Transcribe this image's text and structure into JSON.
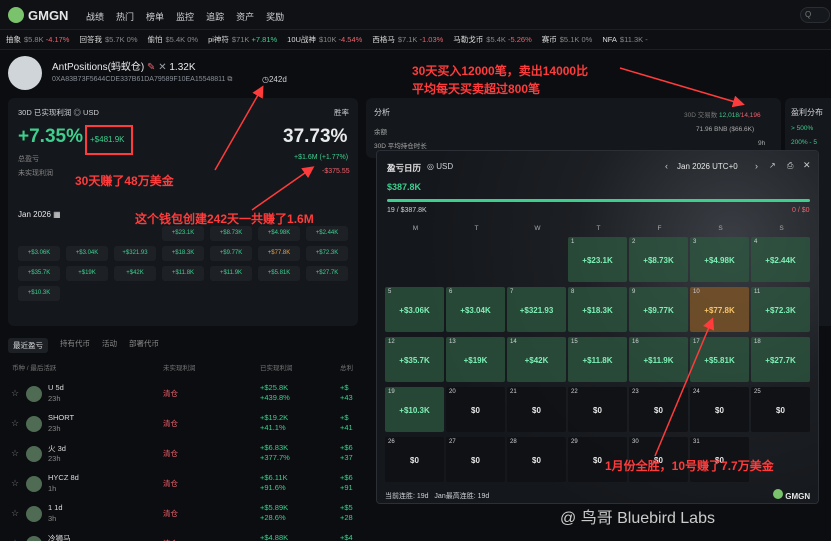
{
  "nav": {
    "brand": "GMGN",
    "links": [
      "战绩",
      "热门",
      "榜单",
      "监控",
      "追踪",
      "资产",
      "奖励"
    ],
    "search_label": "Q"
  },
  "ticker": [
    {
      "name": "抽象",
      "price": "$5.8K",
      "change": "-4.17%",
      "dir": "down"
    },
    {
      "name": "回答我",
      "price": "$5.7K",
      "change": "0%",
      "dir": "flat"
    },
    {
      "name": "偷怕",
      "price": "$5.4K",
      "change": "0%",
      "dir": "flat"
    },
    {
      "name": "pi神符",
      "price": "$71K",
      "change": "+7.81%",
      "dir": "up"
    },
    {
      "name": "10U战神",
      "price": "$10K",
      "change": "-4.54%",
      "dir": "down"
    },
    {
      "name": "西格马",
      "price": "$7.1K",
      "change": "-1.03%",
      "dir": "down"
    },
    {
      "name": "马勒戈币",
      "price": "$5.4K",
      "change": "-5.26%",
      "dir": "down"
    },
    {
      "name": "赛币",
      "price": "$5.1K",
      "change": "0%",
      "dir": "flat"
    },
    {
      "name": "NFA",
      "price": "$11.3K",
      "change": "-",
      "dir": "flat"
    }
  ],
  "profile": {
    "name": "AntPositions(蚂蚁仓)",
    "followers": "1.32K",
    "address": "0XA83B73F5644CDE337B61DA79589F10EA15548811",
    "days": "242d"
  },
  "summary": {
    "label": "30D 已实现利润",
    "currency": "USD",
    "winrate_label": "胜率",
    "pct": "+7.35%",
    "pnl": "+$481.9K",
    "winrate": "37.73%",
    "total_label": "总盈亏",
    "total_value": "+$1.6M (+1.77%)",
    "unreal_label": "未实现利润",
    "unreal_value": "-$375.55",
    "month": "Jan 2026",
    "mini_pills": [
      [
        "",
        "",
        "",
        "+$23.1K",
        "+$8.73K",
        "+$4.98K",
        "+$2.44K"
      ],
      [
        "+$3.06K",
        "+$3.04K",
        "+$321.93",
        "+$18.3K",
        "+$9.77K",
        "+$77.8K",
        "+$72.3K"
      ],
      [
        "+$35.7K",
        "+$19K",
        "+$42K",
        "+$11.8K",
        "+$11.9K",
        "+$5.81K",
        "+$27.7K"
      ],
      [
        "+$10.3K",
        "",
        "",
        "",
        "",
        "",
        ""
      ]
    ]
  },
  "analysis": {
    "title": "分析",
    "tx_label": "30D 交易数",
    "tx_buy": "12,018",
    "tx_sell": "14,196",
    "rows": [
      {
        "label": "余额",
        "value": "71.96 BNB ($66.6K)"
      },
      {
        "label": "30D 平均持仓时长",
        "value": "9h"
      }
    ],
    "side_title": "盈利分布",
    "side_items": [
      "> 500%",
      "200% - 5"
    ]
  },
  "table": {
    "tabs": [
      "最近盈亏",
      "持有代币",
      "活动",
      "部署代币"
    ],
    "headers": [
      "币种 / 最后活跃",
      "未实现利润",
      "已实现利润",
      "总利"
    ],
    "rows": [
      {
        "name": "U",
        "age": "23h",
        "sub": "5d",
        "status": "清仓",
        "pnl": "+$25.8K",
        "pct": "+439.8%",
        "pnl2": "+$",
        "pct2": "+43"
      },
      {
        "name": "SHORT",
        "age": "23h",
        "sub": "",
        "status": "清仓",
        "pnl": "+$19.2K",
        "pct": "+41.1%",
        "pnl2": "+$",
        "pct2": "+41"
      },
      {
        "name": "火",
        "age": "23h",
        "sub": "3d",
        "status": "清仓",
        "pnl": "+$6.83K",
        "pct": "+377.7%",
        "pnl2": "+$6",
        "pct2": "+37"
      },
      {
        "name": "HYCZ",
        "age": "1h",
        "sub": "8d",
        "status": "清仓",
        "pnl": "+$6.11K",
        "pct": "+91.6%",
        "pnl2": "+$6",
        "pct2": "+91"
      },
      {
        "name": "1",
        "age": "3h",
        "sub": "1d",
        "status": "清仓",
        "pnl": "+$5.89K",
        "pct": "+28.6%",
        "pnl2": "+$5",
        "pct2": "+28"
      },
      {
        "name": "冷狮马",
        "age": "",
        "sub": "",
        "status": "清仓",
        "pnl": "+$4.88K",
        "pct": "",
        "pnl2": "+$4",
        "pct2": ""
      }
    ]
  },
  "calendar": {
    "title": "盈亏日历",
    "currency": "USD",
    "month": "Jan 2026 UTC+0",
    "total": "$387.8K",
    "wins": "19 / $387.8K",
    "losses": "0 / $0",
    "weekdays": [
      "M",
      "T",
      "W",
      "T",
      "F",
      "S",
      "S"
    ],
    "days": [
      {
        "d": "",
        "v": ""
      },
      {
        "d": "",
        "v": ""
      },
      {
        "d": "",
        "v": ""
      },
      {
        "d": "1",
        "v": "+$23.1K"
      },
      {
        "d": "2",
        "v": "+$8.73K"
      },
      {
        "d": "3",
        "v": "+$4.98K"
      },
      {
        "d": "4",
        "v": "+$2.44K"
      },
      {
        "d": "5",
        "v": "+$3.06K"
      },
      {
        "d": "6",
        "v": "+$3.04K"
      },
      {
        "d": "7",
        "v": "+$321.93"
      },
      {
        "d": "8",
        "v": "+$18.3K"
      },
      {
        "d": "9",
        "v": "+$9.77K"
      },
      {
        "d": "10",
        "v": "+$77.8K"
      },
      {
        "d": "11",
        "v": "+$72.3K"
      },
      {
        "d": "12",
        "v": "+$35.7K"
      },
      {
        "d": "13",
        "v": "+$19K"
      },
      {
        "d": "14",
        "v": "+$42K"
      },
      {
        "d": "15",
        "v": "+$11.8K"
      },
      {
        "d": "16",
        "v": "+$11.9K"
      },
      {
        "d": "17",
        "v": "+$5.81K"
      },
      {
        "d": "18",
        "v": "+$27.7K"
      },
      {
        "d": "19",
        "v": "+$10.3K"
      },
      {
        "d": "20",
        "v": "$0"
      },
      {
        "d": "21",
        "v": "$0"
      },
      {
        "d": "22",
        "v": "$0"
      },
      {
        "d": "23",
        "v": "$0"
      },
      {
        "d": "24",
        "v": "$0"
      },
      {
        "d": "25",
        "v": "$0"
      },
      {
        "d": "26",
        "v": "$0"
      },
      {
        "d": "27",
        "v": "$0"
      },
      {
        "d": "28",
        "v": "$0"
      },
      {
        "d": "29",
        "v": "$0"
      },
      {
        "d": "30",
        "v": "$0"
      },
      {
        "d": "31",
        "v": "$0"
      },
      {
        "d": "",
        "v": ""
      }
    ],
    "streak": "当前连胜: 19d",
    "max_streak": "Jan最高连胜: 19d",
    "brand": "GMGN"
  },
  "annotations": {
    "a1_line1": "30天买入12000笔，卖出14000比",
    "a1_line2": "平均每天买卖超过800笔",
    "a2": "30天赚了48万美金",
    "a3": "这个钱包创建242天一共赚了1.6M",
    "a4": "1月份全胜，10号赚了7.7万美金"
  },
  "watermark": "@ 鸟哥 Bluebird Labs",
  "colors": {
    "green": "#3ecf8e",
    "red": "#f0616d",
    "annotation": "#ff3b3b"
  }
}
